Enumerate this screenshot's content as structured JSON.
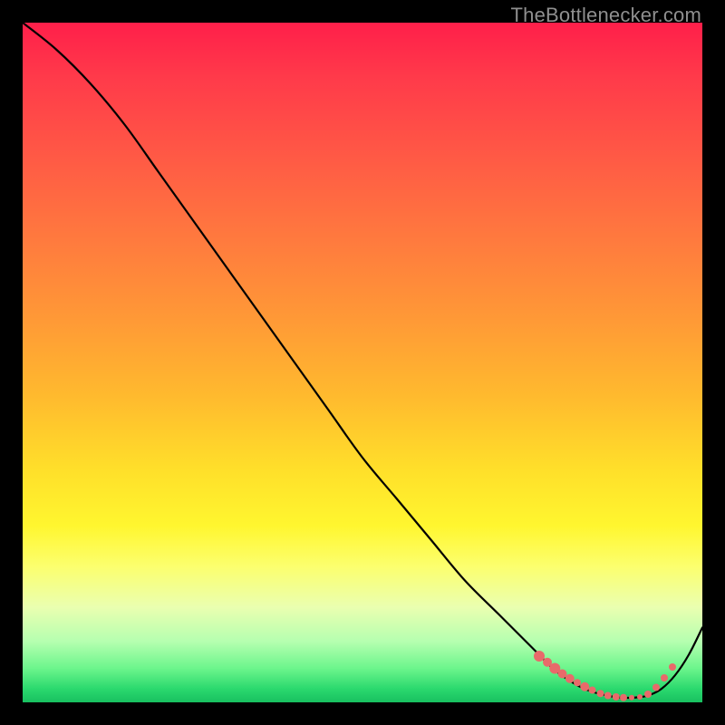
{
  "watermark": "TheBottlenecker.com",
  "chart_data": {
    "type": "line",
    "title": "",
    "xlabel": "",
    "ylabel": "",
    "xlim": [
      0,
      100
    ],
    "ylim": [
      0,
      100
    ],
    "grid": false,
    "legend": false,
    "series": [
      {
        "name": "curve",
        "x": [
          0,
          5,
          10,
          15,
          20,
          25,
          30,
          35,
          40,
          45,
          50,
          55,
          60,
          65,
          70,
          75,
          78,
          80,
          82,
          84,
          86,
          88,
          90,
          92,
          94,
          96,
          98,
          100
        ],
        "y": [
          100,
          96,
          91,
          85,
          78,
          71,
          64,
          57,
          50,
          43,
          36,
          30,
          24,
          18,
          13,
          8,
          5,
          3.5,
          2.3,
          1.5,
          1.0,
          0.7,
          0.7,
          1.0,
          2.0,
          4.0,
          7.0,
          11
        ]
      }
    ],
    "markers": [
      {
        "x": 76.0,
        "y": 6.8,
        "r": 6
      },
      {
        "x": 77.2,
        "y": 5.9,
        "r": 5
      },
      {
        "x": 78.3,
        "y": 5.0,
        "r": 6
      },
      {
        "x": 79.4,
        "y": 4.2,
        "r": 5
      },
      {
        "x": 80.5,
        "y": 3.5,
        "r": 5
      },
      {
        "x": 81.6,
        "y": 2.9,
        "r": 4
      },
      {
        "x": 82.7,
        "y": 2.3,
        "r": 5
      },
      {
        "x": 83.8,
        "y": 1.8,
        "r": 4
      },
      {
        "x": 85.0,
        "y": 1.3,
        "r": 4
      },
      {
        "x": 86.1,
        "y": 1.0,
        "r": 4
      },
      {
        "x": 87.3,
        "y": 0.8,
        "r": 4
      },
      {
        "x": 88.4,
        "y": 0.7,
        "r": 4
      },
      {
        "x": 89.6,
        "y": 0.7,
        "r": 3
      },
      {
        "x": 90.8,
        "y": 0.8,
        "r": 3
      },
      {
        "x": 92.0,
        "y": 1.2,
        "r": 4
      },
      {
        "x": 93.2,
        "y": 2.2,
        "r": 4
      },
      {
        "x": 94.4,
        "y": 3.6,
        "r": 4
      },
      {
        "x": 95.6,
        "y": 5.2,
        "r": 4
      }
    ],
    "colors": {
      "line": "#000000",
      "marker": "#e86a6a"
    }
  }
}
